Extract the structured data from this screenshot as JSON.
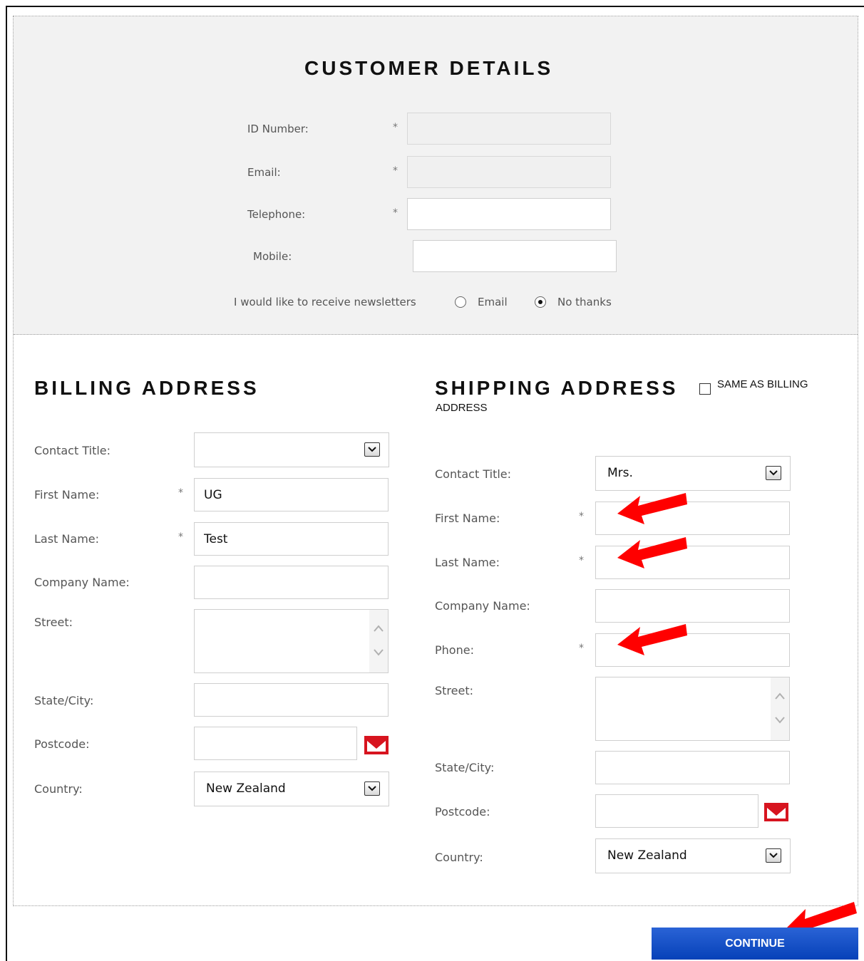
{
  "customer_details": {
    "title": "CUSTOMER DETAILS",
    "id_number_label": "ID Number:",
    "email_label": "Email:",
    "telephone_label": "Telephone:",
    "mobile_label": "Mobile:",
    "required_mark": "*",
    "id_number_value": "",
    "email_value": "",
    "telephone_value": "",
    "mobile_value": "",
    "newsletter_label": "I would like to receive newsletters",
    "newsletter_options": [
      "Email",
      "No thanks"
    ],
    "newsletter_selected": "No thanks"
  },
  "billing": {
    "title": "BILLING ADDRESS",
    "contact_title_label": "Contact Title:",
    "contact_title_value": "",
    "first_name_label": "First Name:",
    "first_name_value": "UG",
    "last_name_label": "Last Name:",
    "last_name_value": "Test",
    "company_label": "Company Name:",
    "company_value": "",
    "street_label": "Street:",
    "state_label": "State/City:",
    "state_value": "",
    "postcode_label": "Postcode:",
    "postcode_value": "",
    "country_label": "Country:",
    "country_value": "New Zealand"
  },
  "shipping": {
    "title": "SHIPPING ADDRESS",
    "same_as_billing_line1": "SAME AS BILLING",
    "same_as_billing_line2": "ADDRESS",
    "same_as_billing_checked": false,
    "contact_title_label": "Contact Title:",
    "contact_title_value": "Mrs.",
    "first_name_label": "First Name:",
    "first_name_value": "",
    "last_name_label": "Last Name:",
    "last_name_value": "",
    "company_label": "Company Name:",
    "company_value": "",
    "phone_label": "Phone:",
    "phone_value": "",
    "street_label": "Street:",
    "state_label": "State/City:",
    "state_value": "",
    "postcode_label": "Postcode:",
    "postcode_value": "",
    "country_label": "Country:",
    "country_value": "New Zealand"
  },
  "actions": {
    "continue_label": "CONTINUE"
  },
  "icons": {
    "postcode_lookup": "mail-envelope-icon",
    "annotation": "red-arrow-icon",
    "select_toggle": "chevron-down-icon"
  },
  "colors": {
    "accent_button": "#0a45c0",
    "annotation_arrow": "#ff0000",
    "mail_icon": "#d7141f"
  }
}
